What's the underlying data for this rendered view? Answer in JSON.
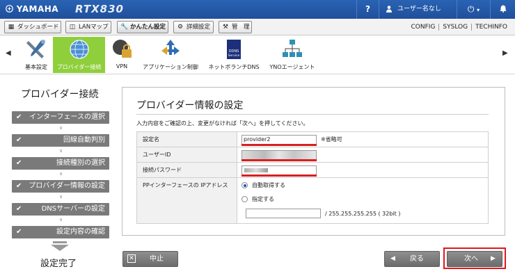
{
  "header": {
    "brand": "YAMAHA",
    "model": "RTX830",
    "help_label": "?",
    "user_label": "ユーザー名なし"
  },
  "menubar": {
    "buttons": [
      {
        "label": "ダッシュボード",
        "icon": "dashboard-icon"
      },
      {
        "label": "LANマップ",
        "icon": "lanmap-icon"
      },
      {
        "label": "かんたん設定",
        "icon": "wrench-user-icon",
        "active": true
      },
      {
        "label": "詳細設定",
        "icon": "gear-icon"
      },
      {
        "label": "管　理",
        "icon": "tools-icon"
      }
    ],
    "links": [
      "CONFIG",
      "SYSLOG",
      "TECHINFO"
    ]
  },
  "iconbar": {
    "items": [
      {
        "label": "基本設定",
        "icon": "tools-icon"
      },
      {
        "label": "プロバイダー接続",
        "icon": "globe-icon",
        "selected": true
      },
      {
        "label": "VPN",
        "icon": "vpn-lock-icon"
      },
      {
        "label": "アプリケーション制御",
        "icon": "app-control-icon"
      },
      {
        "label": "ネットボランチDNS",
        "icon": "ddns-service-icon",
        "icon_text": "DDNS Service"
      },
      {
        "label": "YNOエージェント",
        "icon": "network-agent-icon"
      }
    ]
  },
  "leftnav": {
    "title": "プロバイダー接続",
    "steps": [
      "インターフェースの選択",
      "回線自動判別",
      "接続種別の選択",
      "プロバイダー情報の設定",
      "DNSサーバーの設定",
      "設定内容の確認"
    ],
    "done": "設定完了"
  },
  "panel": {
    "title": "プロバイダー情報の設定",
    "description": "入力内容をご確認の上、変更がなければ「次へ」を押してください。",
    "rows": {
      "name_label": "設定名",
      "name_value": "provider2",
      "name_note": "※省略可",
      "userid_label": "ユーザーID",
      "password_label": "接続パスワード",
      "pp_label": "PPインターフェースの IPアドレス",
      "radio_auto": "自動取得する",
      "radio_manual": "指定する",
      "mask_suffix": "/ 255.255.255.255 ( 32bit )"
    }
  },
  "footer": {
    "cancel_label": "中止",
    "back_label": "戻る",
    "next_label": "次へ"
  },
  "colors": {
    "header_bg": "#1f4f9a",
    "selected_tab": "#8fcf3c",
    "step_bg": "#7a7a7a",
    "highlight_red": "#e01919"
  }
}
